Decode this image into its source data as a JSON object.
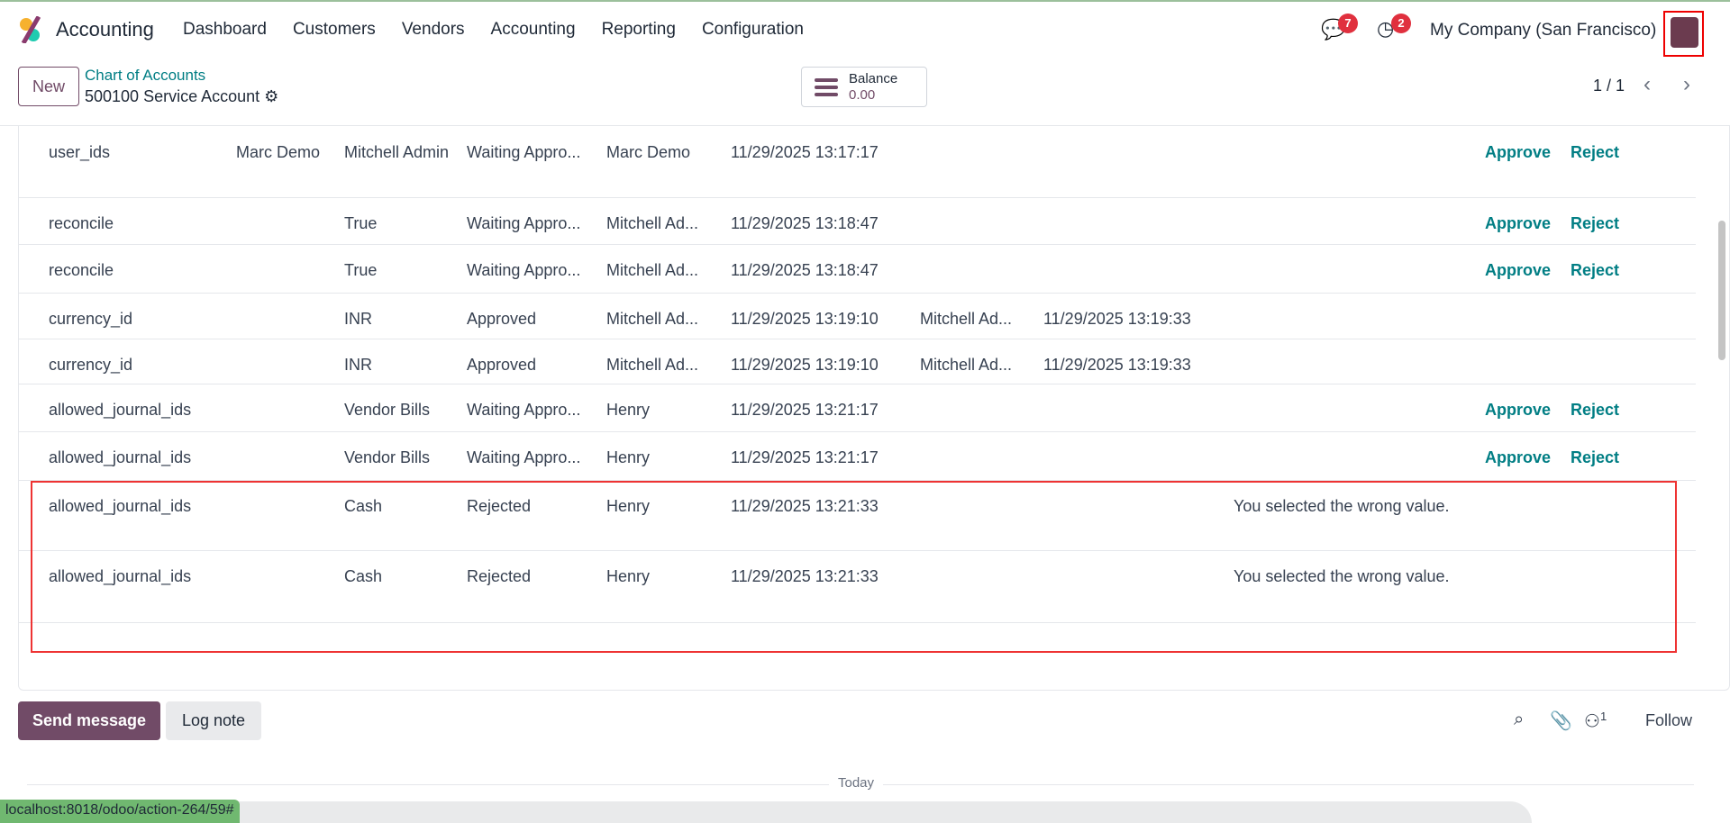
{
  "nav": {
    "app": "Accounting",
    "menu": [
      "Dashboard",
      "Customers",
      "Vendors",
      "Accounting",
      "Reporting",
      "Configuration"
    ],
    "messages_count": "7",
    "activities_count": "2",
    "company": "My Company (San Francisco)"
  },
  "control": {
    "new_label": "New",
    "breadcrumb_parent": "Chart of Accounts",
    "record_title": "500100 Service Account",
    "balance_label": "Balance",
    "balance_value": "0.00",
    "pager": "1 / 1"
  },
  "rows": [
    {
      "field": "user_ids",
      "old": "Marc Demo",
      "new": "Mitchell Admin",
      "state": "Waiting Appro...",
      "requested_by": "Marc Demo",
      "requested_on": "11/29/2025 13:17:17",
      "approved_by": "",
      "approved_on": "",
      "reason": "",
      "approve": "Approve",
      "reject": "Reject"
    },
    {
      "field": "reconcile",
      "old": "",
      "new": "True",
      "state": "Waiting Appro...",
      "requested_by": "Mitchell Ad...",
      "requested_on": "11/29/2025 13:18:47",
      "approved_by": "",
      "approved_on": "",
      "reason": "",
      "approve": "Approve",
      "reject": "Reject"
    },
    {
      "field": "reconcile",
      "old": "",
      "new": "True",
      "state": "Waiting Appro...",
      "requested_by": "Mitchell Ad...",
      "requested_on": "11/29/2025 13:18:47",
      "approved_by": "",
      "approved_on": "",
      "reason": "",
      "approve": "Approve",
      "reject": "Reject"
    },
    {
      "field": "currency_id",
      "old": "",
      "new": "INR",
      "state": "Approved",
      "requested_by": "Mitchell Ad...",
      "requested_on": "11/29/2025 13:19:10",
      "approved_by": "Mitchell Ad...",
      "approved_on": "11/29/2025 13:19:33",
      "reason": "",
      "approve": "",
      "reject": ""
    },
    {
      "field": "currency_id",
      "old": "",
      "new": "INR",
      "state": "Approved",
      "requested_by": "Mitchell Ad...",
      "requested_on": "11/29/2025 13:19:10",
      "approved_by": "Mitchell Ad...",
      "approved_on": "11/29/2025 13:19:33",
      "reason": "",
      "approve": "",
      "reject": ""
    },
    {
      "field": "allowed_journal_ids",
      "old": "",
      "new": "Vendor Bills",
      "state": "Waiting Appro...",
      "requested_by": "Henry",
      "requested_on": "11/29/2025 13:21:17",
      "approved_by": "",
      "approved_on": "",
      "reason": "",
      "approve": "Approve",
      "reject": "Reject"
    },
    {
      "field": "allowed_journal_ids",
      "old": "",
      "new": "Vendor Bills",
      "state": "Waiting Appro...",
      "requested_by": "Henry",
      "requested_on": "11/29/2025 13:21:17",
      "approved_by": "",
      "approved_on": "",
      "reason": "",
      "approve": "Approve",
      "reject": "Reject"
    },
    {
      "field": "allowed_journal_ids",
      "old": "",
      "new": "Cash",
      "state": "Rejected",
      "requested_by": "Henry",
      "requested_on": "11/29/2025 13:21:33",
      "approved_by": "",
      "approved_on": "",
      "reason": "You selected the wrong value.",
      "approve": "",
      "reject": ""
    },
    {
      "field": "allowed_journal_ids",
      "old": "",
      "new": "Cash",
      "state": "Rejected",
      "requested_by": "Henry",
      "requested_on": "11/29/2025 13:21:33",
      "approved_by": "",
      "approved_on": "",
      "reason": "You selected the wrong value.",
      "approve": "",
      "reject": ""
    }
  ],
  "chatter": {
    "send_message": "Send message",
    "log_note": "Log note",
    "followers_count": "1",
    "follow": "Follow",
    "today": "Today"
  },
  "statusbar": {
    "url": "localhost:8018/odoo/action-264/59#"
  }
}
